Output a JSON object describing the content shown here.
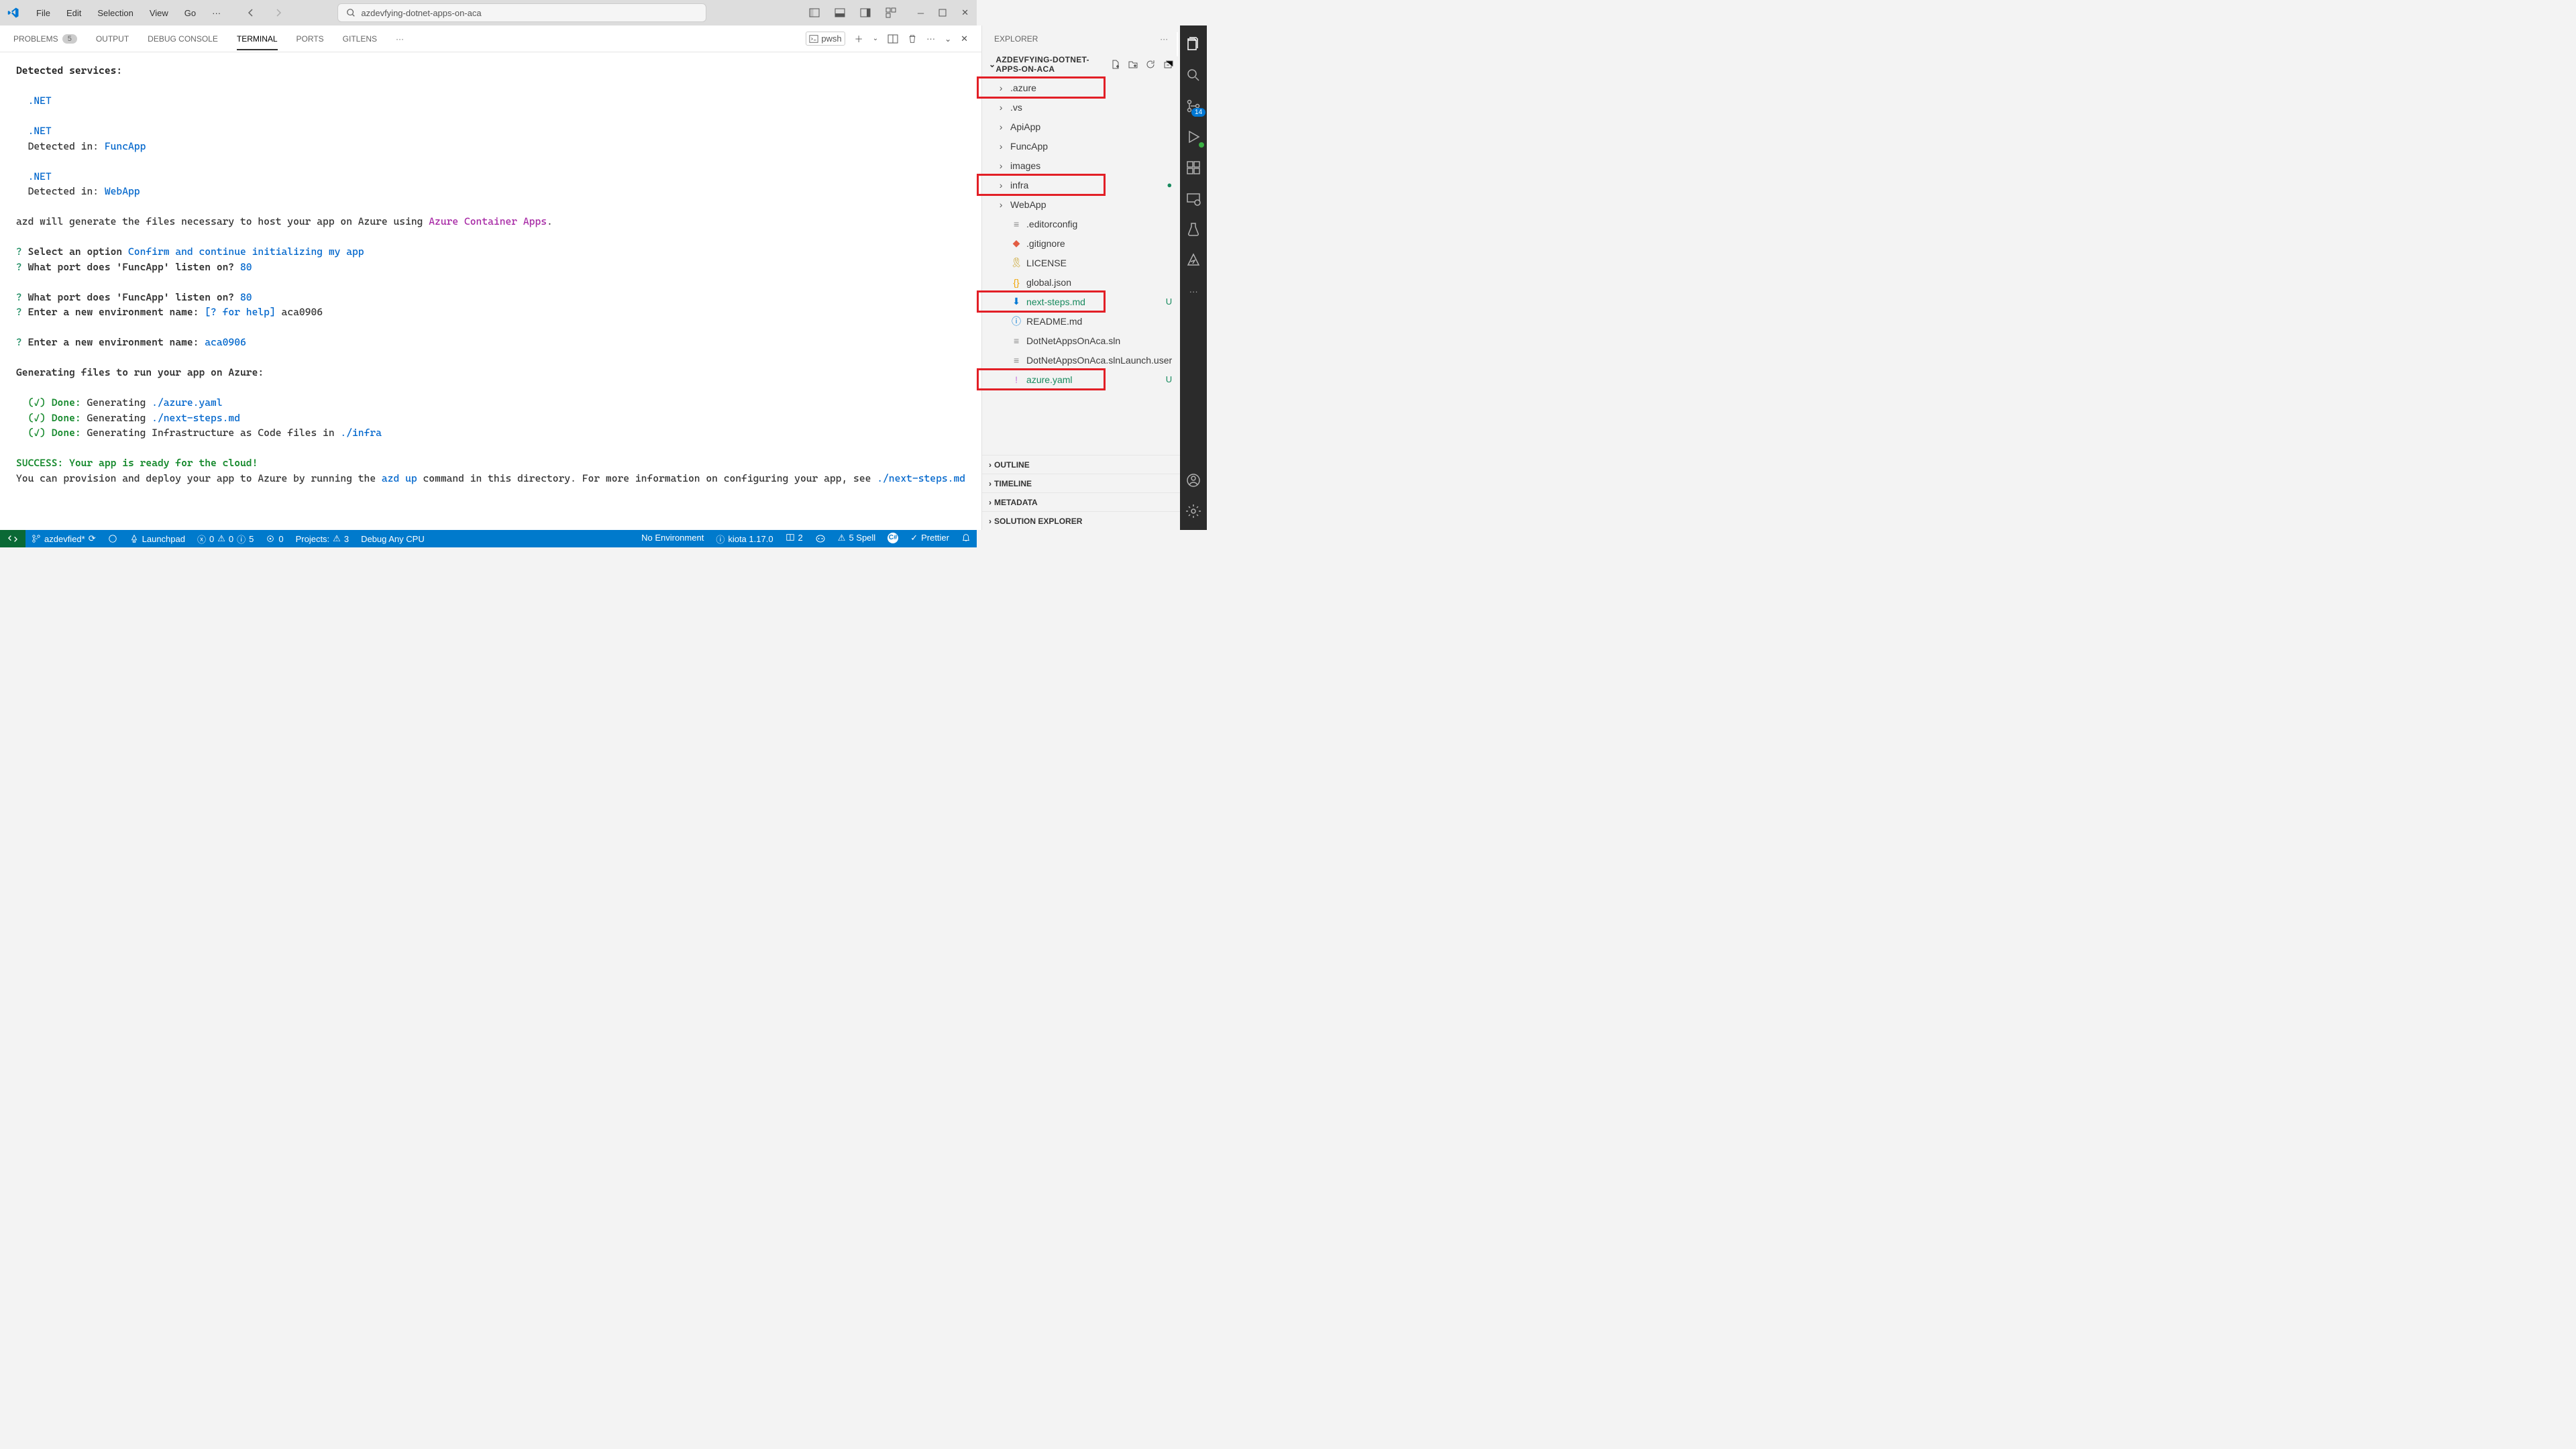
{
  "titlebar": {
    "menus": [
      "File",
      "Edit",
      "Selection",
      "View",
      "Go"
    ],
    "search_text": "azdevfying-dotnet-apps-on-aca"
  },
  "panel": {
    "tabs": {
      "problems": "PROBLEMS",
      "problems_count": "5",
      "output": "OUTPUT",
      "debug": "DEBUG CONSOLE",
      "terminal": "TERMINAL",
      "ports": "PORTS",
      "gitlens": "GITLENS"
    },
    "shell_name": "pwsh"
  },
  "terminal": {
    "l1": "Detected services:",
    "dotnet": ".NET",
    "detin": "Detected in: ",
    "funcapp": "FuncApp",
    "webapp": "WebApp",
    "azd1": "azd will generate the files necessary to host your app on Azure using ",
    "aca": "Azure Container Apps",
    "dot": ".",
    "q": "?",
    "selopt": " Select an option ",
    "confirm": "Confirm and continue initializing my app",
    "port_q": " What port does 'FuncApp' listen on? ",
    "port_a": "80",
    "env_q": " Enter a new environment name: ",
    "help": "[? for help]",
    "envname": " aca0906",
    "envname_blue": "aca0906",
    "gen_header": "Generating files to run your app on Azure:",
    "check": "(✓) ",
    "done": "Done:",
    "gen": " Generating ",
    "gf1": "./azure.yaml",
    "gf2": "./next-steps.md",
    "gen_infra": " Generating Infrastructure as Code files in ",
    "gf3": "./infra",
    "success": "SUCCESS: Your app is ready for the cloud!",
    "tail1a": "You can provision and deploy your app to Azure by running the ",
    "tail1b": "azd up",
    "tail1c": " command in this directory. For more information on configuring your app, see ",
    "tail1d": "./next-steps.md"
  },
  "explorer": {
    "title": "EXPLORER",
    "root": "AZDEVFYING-DOTNET-APPS-ON-ACA",
    "items": [
      {
        "name": ".azure",
        "folder": true,
        "highlight": true
      },
      {
        "name": ".vs",
        "folder": true
      },
      {
        "name": "ApiApp",
        "folder": true
      },
      {
        "name": "FuncApp",
        "folder": true
      },
      {
        "name": "images",
        "folder": true
      },
      {
        "name": "infra",
        "folder": true,
        "highlight": true,
        "greendot": true
      },
      {
        "name": "WebApp",
        "folder": true
      },
      {
        "name": ".editorconfig",
        "icon": "gear"
      },
      {
        "name": ".gitignore",
        "icon": "git"
      },
      {
        "name": "LICENSE",
        "icon": "license"
      },
      {
        "name": "global.json",
        "icon": "json"
      },
      {
        "name": "next-steps.md",
        "icon": "md",
        "highlight": true,
        "green": true,
        "decor": "U"
      },
      {
        "name": "README.md",
        "icon": "info"
      },
      {
        "name": "DotNetAppsOnAca.sln",
        "icon": "gear"
      },
      {
        "name": "DotNetAppsOnAca.slnLaunch.user",
        "icon": "gear"
      },
      {
        "name": "azure.yaml",
        "icon": "yaml",
        "highlight": true,
        "green": true,
        "decor": "U"
      }
    ],
    "sections": [
      "OUTLINE",
      "TIMELINE",
      "METADATA",
      "SOLUTION EXPLORER"
    ]
  },
  "activitybar": {
    "scm_badge": "14"
  },
  "status": {
    "branch": "azdevfied*",
    "launchpad": "Launchpad",
    "err": "0",
    "warn": "0",
    "info": "5",
    "ports": "0",
    "projects": "Projects:",
    "projects_warn": "3",
    "debug": "Debug Any CPU",
    "no_env": "No Environment",
    "kiota": "kiota 1.17.0",
    "editors": "2",
    "spell": "5 Spell",
    "prettier": "Prettier"
  }
}
